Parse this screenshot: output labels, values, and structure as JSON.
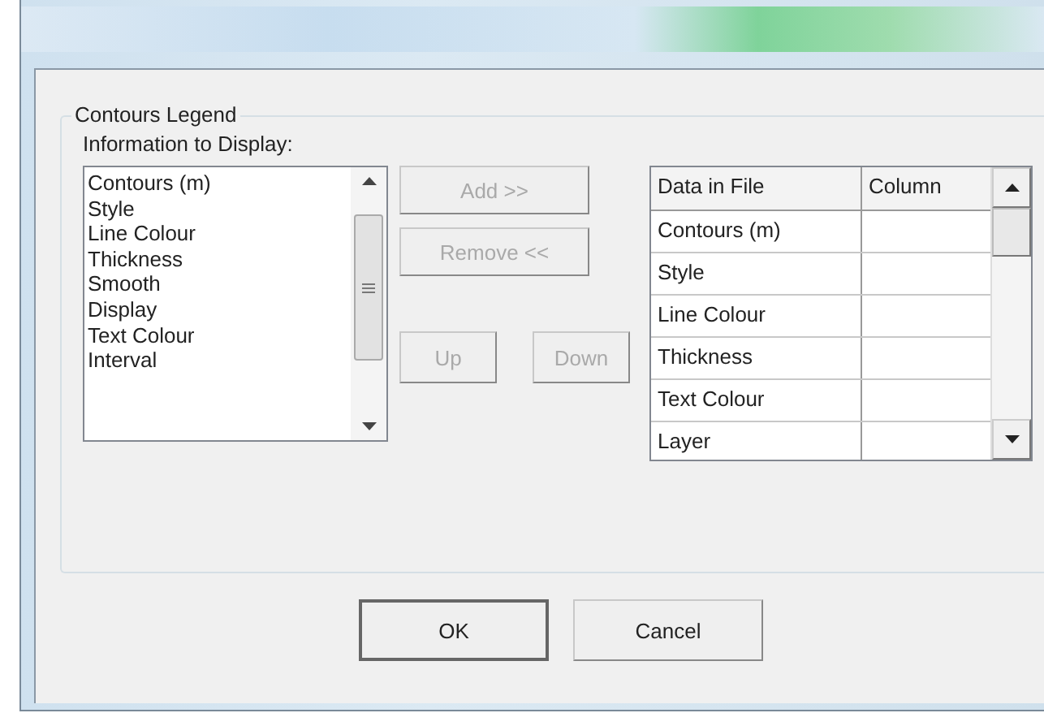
{
  "group": {
    "title": "Contours Legend"
  },
  "info_label": "Information to Display:",
  "available_items": [
    "Contours (m)",
    "Style",
    "Line Colour",
    "Thickness",
    "Smooth",
    "Display",
    "Text Colour",
    "Interval"
  ],
  "move_buttons": [
    {
      "label": "Add >>",
      "kind": "wide",
      "disabled": true
    },
    {
      "label": "Remove <<",
      "kind": "wide",
      "disabled": true
    },
    {
      "label": "Up",
      "kind": "small",
      "disabled": true
    },
    {
      "label": "Down",
      "kind": "small",
      "disabled": true
    }
  ],
  "table": {
    "columns": [
      "Data in File",
      "Column"
    ],
    "rows": [
      "Contours (m)",
      "Style",
      "Line Colour",
      "Thickness",
      "Text Colour",
      "Layer"
    ]
  },
  "dialog_buttons": [
    {
      "label": "OK",
      "default": true
    },
    {
      "label": "Cancel",
      "default": false
    }
  ]
}
